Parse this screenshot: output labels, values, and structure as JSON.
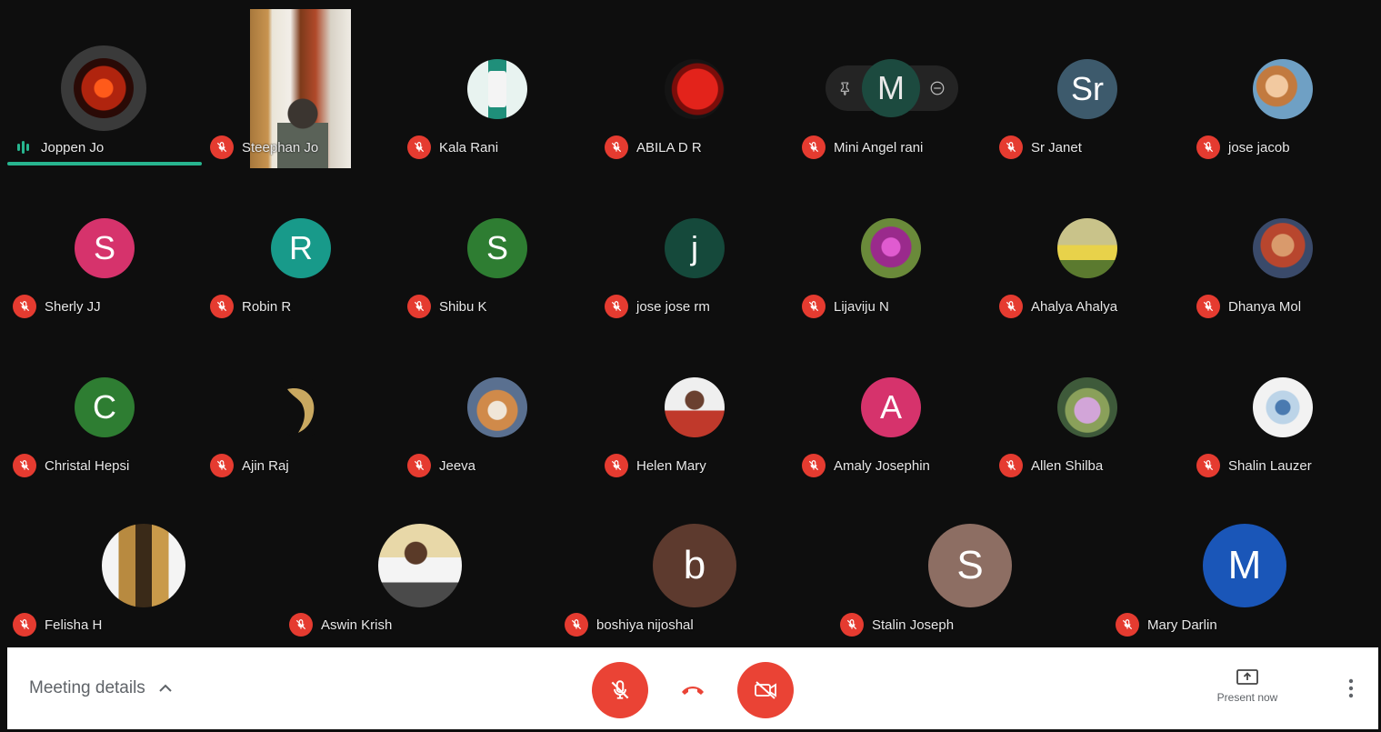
{
  "participants": {
    "p1": {
      "name": "Joppen Jo"
    },
    "p2": {
      "name": "Steephan Jo"
    },
    "p3": {
      "name": "Kala Rani"
    },
    "p4": {
      "name": "ABILA D R"
    },
    "p5": {
      "name": "Mini Angel rani",
      "initial": "M"
    },
    "p6": {
      "name": "Sr Janet",
      "initial": "Sr"
    },
    "p7": {
      "name": "jose jacob"
    },
    "p8": {
      "name": "Sherly JJ",
      "initial": "S"
    },
    "p9": {
      "name": "Robin R",
      "initial": "R"
    },
    "p10": {
      "name": "Shibu K",
      "initial": "S"
    },
    "p11": {
      "name": "jose jose rm",
      "initial": "j"
    },
    "p12": {
      "name": "Lijaviju N"
    },
    "p13": {
      "name": "Ahalya Ahalya"
    },
    "p14": {
      "name": "Dhanya Mol"
    },
    "p15": {
      "name": "Christal Hepsi",
      "initial": "C"
    },
    "p16": {
      "name": "Ajin Raj"
    },
    "p17": {
      "name": "Jeeva"
    },
    "p18": {
      "name": "Helen Mary"
    },
    "p19": {
      "name": "Amaly Josephin",
      "initial": "A"
    },
    "p20": {
      "name": "Allen Shilba"
    },
    "p21": {
      "name": "Shalin Lauzer"
    },
    "p22": {
      "name": "Felisha H"
    },
    "p23": {
      "name": "Aswin Krish"
    },
    "p24": {
      "name": "boshiya nijoshal",
      "initial": "b"
    },
    "p25": {
      "name": "Stalin Joseph",
      "initial": "S"
    },
    "p26": {
      "name": "Mary Darlin",
      "initial": "M"
    }
  },
  "toolbar": {
    "meeting_details_label": "Meeting details",
    "present_label": "Present now"
  },
  "colors": {
    "mic_off_red": "#e53b30",
    "speaking_teal": "#27b58f",
    "control_red": "#ea4335"
  }
}
